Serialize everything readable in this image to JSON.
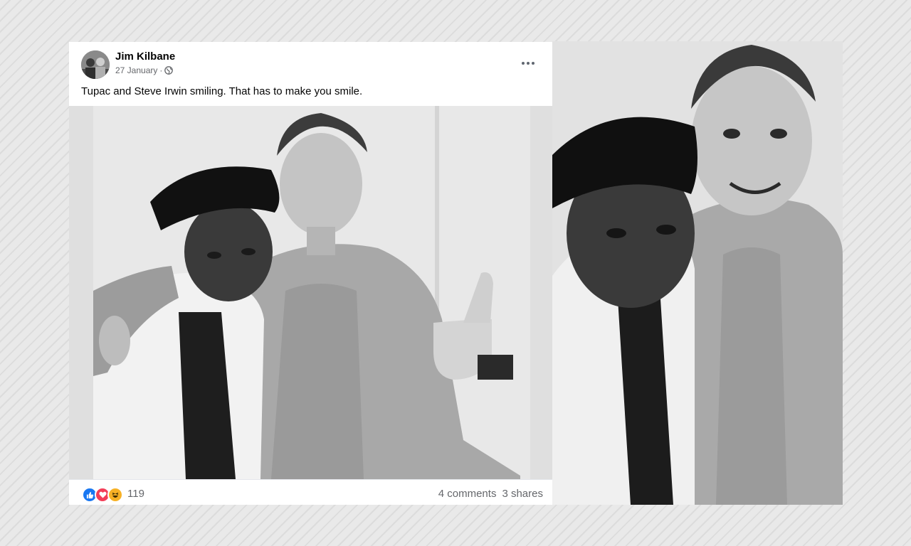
{
  "post": {
    "author": "Jim Kilbane",
    "date": "27 January",
    "separator": "·",
    "privacy_icon": "globe-icon",
    "caption": "Tupac and Steve Irwin smiling. That has to make you smile.",
    "menu_icon": "more-options-icon",
    "reactions": {
      "icons": [
        "like-icon",
        "love-icon",
        "haha-icon"
      ],
      "count": "119"
    },
    "comments": "4 comments",
    "shares": "3 shares"
  },
  "colors": {
    "like": "#1877f2",
    "love": "#f33e58",
    "haha": "#f7b125",
    "secondary_text": "#65676b"
  }
}
